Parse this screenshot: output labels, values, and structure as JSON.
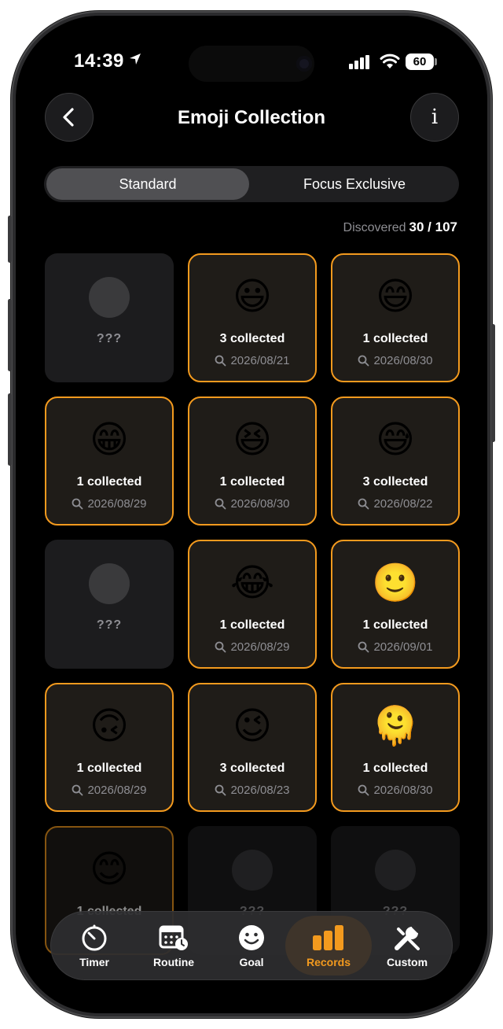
{
  "status_bar": {
    "time": "14:39",
    "battery": "60"
  },
  "header": {
    "title": "Emoji Collection",
    "back_icon": "chevron-left-icon",
    "info_label": "i"
  },
  "segments": {
    "standard": "Standard",
    "focus": "Focus Exclusive",
    "selected": "standard"
  },
  "discovered": {
    "label": "Discovered",
    "count": "30 / 107"
  },
  "cards": [
    {
      "state": "locked",
      "label": "???"
    },
    {
      "state": "found",
      "emoji": "😃",
      "collected": "3 collected",
      "date": "2026/08/21"
    },
    {
      "state": "found",
      "emoji": "😄",
      "collected": "1 collected",
      "date": "2026/08/30"
    },
    {
      "state": "found",
      "emoji": "😁",
      "collected": "1 collected",
      "date": "2026/08/29"
    },
    {
      "state": "found",
      "emoji": "😆",
      "collected": "1 collected",
      "date": "2026/08/30"
    },
    {
      "state": "found",
      "emoji": "😅",
      "collected": "3 collected",
      "date": "2026/08/22"
    },
    {
      "state": "locked",
      "label": "???"
    },
    {
      "state": "found",
      "emoji": "😂",
      "collected": "1 collected",
      "date": "2026/08/29"
    },
    {
      "state": "found",
      "emoji": "🙂",
      "collected": "1 collected",
      "date": "2026/09/01"
    },
    {
      "state": "found",
      "emoji": "🙃",
      "collected": "1 collected",
      "date": "2026/08/29"
    },
    {
      "state": "found",
      "emoji": "😉",
      "collected": "3 collected",
      "date": "2026/08/23"
    },
    {
      "state": "found",
      "emoji": "🫠",
      "collected": "1 collected",
      "date": "2026/08/30"
    },
    {
      "state": "found",
      "emoji": "😊",
      "collected": "1 collected",
      "date": ""
    },
    {
      "state": "locked",
      "label": "???"
    },
    {
      "state": "locked",
      "label": "???"
    }
  ],
  "tabs": [
    {
      "label": "Timer",
      "icon": "stopwatch-icon"
    },
    {
      "label": "Routine",
      "icon": "calendar-clock-icon"
    },
    {
      "label": "Goal",
      "icon": "smiley-icon"
    },
    {
      "label": "Records",
      "icon": "bar-chart-icon",
      "active": true
    },
    {
      "label": "Custom",
      "icon": "wrench-screwdriver-icon"
    }
  ],
  "colors": {
    "accent": "#f39a1e",
    "background": "#000000",
    "card": "#1c1c1e",
    "muted": "#8e8e93"
  }
}
